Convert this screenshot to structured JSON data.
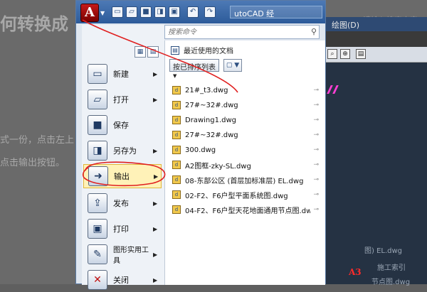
{
  "background": {
    "article_title": "何转换成",
    "paragraph_1": "式一份，点击左上",
    "paragraph_2": "点击输出按钮。",
    "search_hint": "请输入搜索内容"
  },
  "acad": {
    "menu_label": "绘图(D)",
    "canvas_text_1": "图) EL.dwg",
    "canvas_text_2": "施工索引",
    "canvas_text_3": "节点图.dwg",
    "a3_label": "A3"
  },
  "qat": {
    "app_button": "A",
    "title": "utoCAD 经",
    "icons": [
      "new-icon",
      "open-icon",
      "save-icon",
      "saveas-icon",
      "print-icon",
      "undo-icon",
      "redo-icon"
    ]
  },
  "search": {
    "placeholder": "搜索命令"
  },
  "recent": {
    "header": "最近使用的文档",
    "sort_label": "按已排序列表",
    "files": [
      "21#_t3.dwg",
      "27#~32#.dwg",
      "Drawing1.dwg",
      "27#~32#.dwg",
      "300.dwg",
      "A2图框-zky-SL.dwg",
      "08-东部公区 (首层加标准层) EL.dwg",
      "02-F2、F6户型平面系统图.dwg",
      "04-F2、F6户型天花地面通用节点图.dwg"
    ]
  },
  "commands": [
    {
      "label": "新建",
      "arrow": "▶"
    },
    {
      "label": "打开",
      "arrow": "▶"
    },
    {
      "label": "保存",
      "arrow": ""
    },
    {
      "label": "另存为",
      "arrow": "▶"
    },
    {
      "label": "输出",
      "arrow": "▶"
    },
    {
      "label": "发布",
      "arrow": "▶"
    },
    {
      "label": "打印",
      "arrow": "▶"
    },
    {
      "label": "图形实用工具",
      "arrow": "▶"
    },
    {
      "label": "关闭",
      "arrow": "▶"
    }
  ],
  "colors": {
    "accent_red": "#e02020",
    "highlight": "#fff2b8"
  }
}
